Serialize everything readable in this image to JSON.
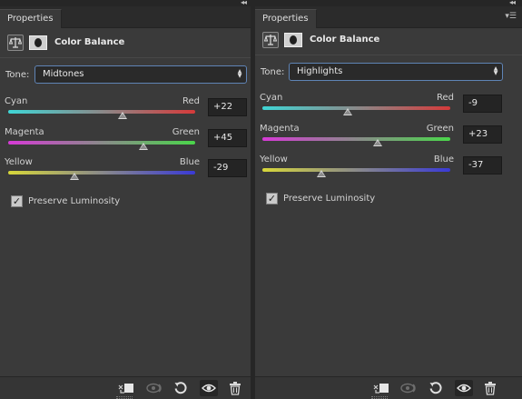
{
  "left_panel": {
    "tab_label": "Properties",
    "adjustment_title": "Color Balance",
    "tone_label": "Tone:",
    "tone_value": "Midtones",
    "sliders": [
      {
        "left_label": "Cyan",
        "right_label": "Red",
        "value": "+22",
        "numeric": 22
      },
      {
        "left_label": "Magenta",
        "right_label": "Green",
        "value": "+45",
        "numeric": 45
      },
      {
        "left_label": "Yellow",
        "right_label": "Blue",
        "value": "-29",
        "numeric": -29
      }
    ],
    "preserve_luminosity_label": "Preserve Luminosity",
    "preserve_luminosity_checked": true
  },
  "right_panel": {
    "tab_label": "Properties",
    "adjustment_title": "Color Balance",
    "tone_label": "Tone:",
    "tone_value": "Highlights",
    "sliders": [
      {
        "left_label": "Cyan",
        "right_label": "Red",
        "value": "-9",
        "numeric": -9
      },
      {
        "left_label": "Magenta",
        "right_label": "Green",
        "value": "+23",
        "numeric": 23
      },
      {
        "left_label": "Yellow",
        "right_label": "Blue",
        "value": "-37",
        "numeric": -37
      }
    ],
    "preserve_luminosity_label": "Preserve Luminosity",
    "preserve_luminosity_checked": true
  },
  "slider_range": [
    -100,
    100
  ],
  "slider_gradients": [
    [
      "#3fd6d6",
      "#8a8a8a",
      "#d63a3a"
    ],
    [
      "#d63ad6",
      "#8a8a8a",
      "#4ad64a"
    ],
    [
      "#d6d63a",
      "#8a8a8a",
      "#3a3ad6"
    ]
  ],
  "icons": {
    "panel_header": [
      "scales-icon",
      "layer-mask-icon"
    ],
    "footer": [
      "clip-to-layer-icon",
      "view-previous-state-icon",
      "reset-icon",
      "visibility-eye-icon",
      "trash-icon"
    ]
  },
  "colors": {
    "panel_bg": "#3a3a3a",
    "select_border": "#5f84b5"
  }
}
